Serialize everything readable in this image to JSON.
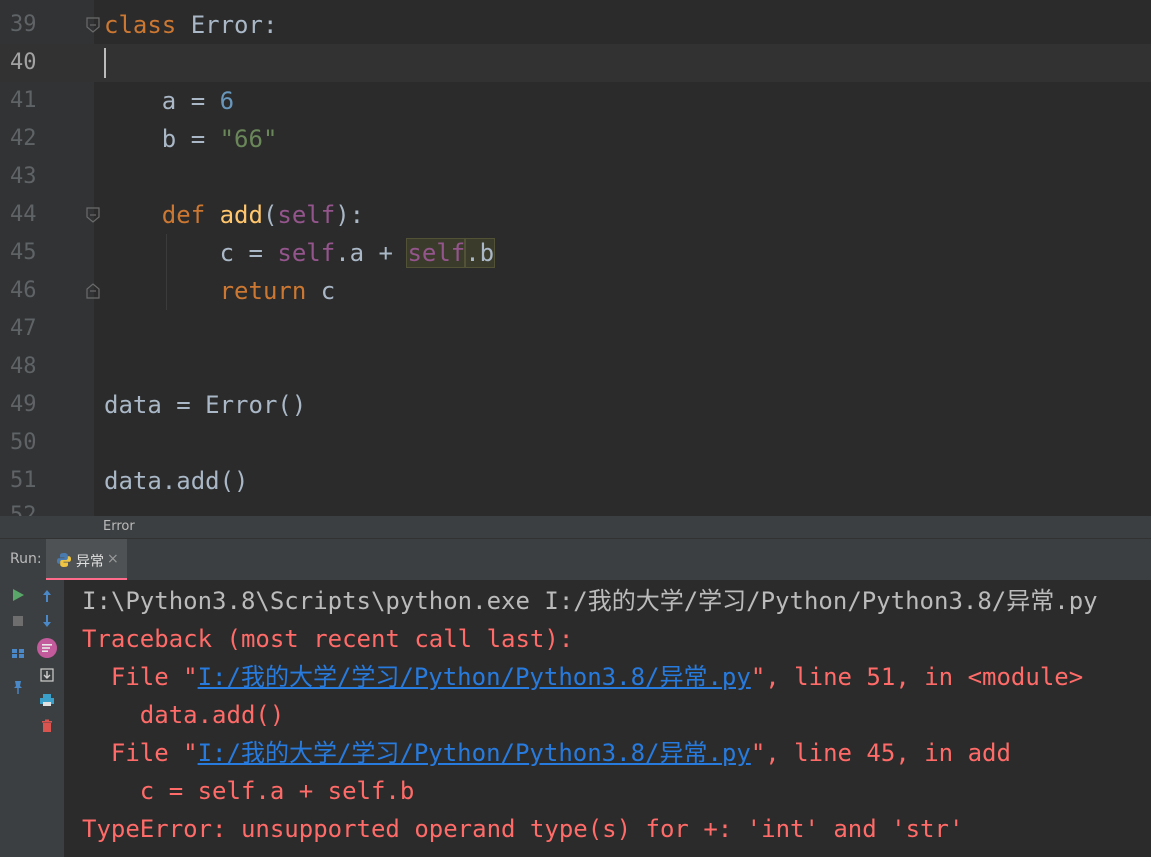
{
  "editor": {
    "lines": [
      {
        "num": "39",
        "tokens": [
          {
            "t": "class ",
            "c": "kw"
          },
          {
            "t": "Error:",
            "c": ""
          }
        ]
      },
      {
        "num": "40",
        "tokens": []
      },
      {
        "num": "41",
        "tokens": [
          {
            "t": "    a = ",
            "c": ""
          },
          {
            "t": "6",
            "c": "num"
          }
        ]
      },
      {
        "num": "42",
        "tokens": [
          {
            "t": "    b = ",
            "c": ""
          },
          {
            "t": "\"66\"",
            "c": "str"
          }
        ]
      },
      {
        "num": "43",
        "tokens": []
      },
      {
        "num": "44",
        "tokens": [
          {
            "t": "    ",
            "c": ""
          },
          {
            "t": "def ",
            "c": "kw"
          },
          {
            "t": "add",
            "c": "fn"
          },
          {
            "t": "(",
            "c": ""
          },
          {
            "t": "self",
            "c": "slf"
          },
          {
            "t": "):",
            "c": ""
          }
        ]
      },
      {
        "num": "45",
        "tokens": [
          {
            "t": "        c = ",
            "c": ""
          },
          {
            "t": "self",
            "c": "slf"
          },
          {
            "t": ".a + ",
            "c": ""
          },
          {
            "t": "self",
            "c": "slf hl"
          },
          {
            "t": ".b",
            "c": "hl"
          }
        ]
      },
      {
        "num": "46",
        "tokens": [
          {
            "t": "        ",
            "c": ""
          },
          {
            "t": "return ",
            "c": "kw"
          },
          {
            "t": "c",
            "c": ""
          }
        ]
      },
      {
        "num": "47",
        "tokens": []
      },
      {
        "num": "48",
        "tokens": []
      },
      {
        "num": "49",
        "tokens": [
          {
            "t": "data = Error()",
            "c": ""
          }
        ]
      },
      {
        "num": "50",
        "tokens": []
      },
      {
        "num": "51",
        "tokens": [
          {
            "t": "data.add()",
            "c": ""
          }
        ]
      }
    ],
    "partial_line_num": "52",
    "breadcrumb": "Error"
  },
  "run": {
    "label": "Run:",
    "tab_label": "异常",
    "tab_close": "×",
    "console": {
      "command": "I:\\Python3.8\\Scripts\\python.exe I:/我的大学/学习/Python/Python3.8/异常.py",
      "traceback_header": "Traceback (most recent call last):",
      "frame1_prefix": "  File \"",
      "frame1_path": "I:/我的大学/学习/Python/Python3.8/异常.py",
      "frame1_suffix": "\", line 51, in <module>",
      "frame1_code": "    data.add()",
      "frame2_prefix": "  File \"",
      "frame2_path": "I:/我的大学/学习/Python/Python3.8/异常.py",
      "frame2_suffix": "\", line 45, in add",
      "frame2_code": "    c = self.a + self.b",
      "error": "TypeError: unsupported operand type(s) for +: 'int' and 'str'"
    }
  },
  "colors": {
    "editor_bg": "#2b2b2b",
    "gutter_bg": "#313335",
    "keyword": "#cc7832",
    "number": "#6897bb",
    "string": "#6a8759",
    "function": "#ffc66d",
    "self": "#94558d",
    "error_text": "#ff6b68",
    "link": "#287bde",
    "tab_underline": "#ff6b8b"
  },
  "toolbar_icons": [
    "rerun-icon",
    "up-arrow-icon",
    "stop-icon",
    "down-arrow-icon",
    "layout-icon",
    "soft-wrap-icon",
    "pin-icon",
    "scroll-to-end-icon",
    "print-icon",
    "trash-icon"
  ]
}
